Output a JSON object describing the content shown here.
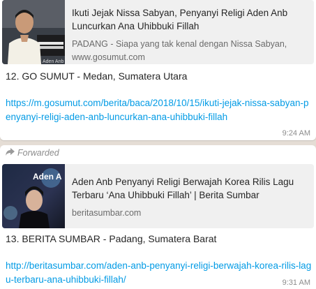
{
  "messages": [
    {
      "preview": {
        "title": "Ikuti Jejak Nissa Sabyan, Penyanyi Religi Aden Anb Luncurkan Ana Uhibbuki Fillah",
        "description": "PADANG - Siapa yang tak kenal dengan Nissa Sabyan,",
        "domain": "www.gosumut.com",
        "thumbnail": "photo-man-with-keyboard"
      },
      "text": "12. GO SUMUT - Medan, Sumatera Utara",
      "link": "https://m.gosumut.com/berita/baca/2018/10/15/ikuti-jejak-nissa-sabyan-penyanyi-religi-aden-anb-luncurkan-ana-uhibbuki-fillah",
      "time": "9:24 AM"
    },
    {
      "forwarded_label": "Forwarded",
      "preview": {
        "title": "Aden Anb Penyanyi Religi Berwajah Korea Rilis Lagu Terbaru ‘Ana Uhibbuki Fillah’ | Berita Sumbar",
        "domain": "beritasumbar.com",
        "thumbnail": "photo-album-cover",
        "thumb_text": "Aden A"
      },
      "text": "13. BERITA SUMBAR - Padang, Sumatera Barat",
      "link": "http://beritasumbar.com/aden-anb-penyanyi-religi-berwajah-korea-rilis-lagu-terbaru-ana-uhibbuki-fillah/",
      "time": "9:31 AM"
    }
  ],
  "colors": {
    "link": "#039be5",
    "bubble": "#ffffff",
    "preview_bg": "#f0f0f0",
    "chat_bg": "#e5ddd5"
  }
}
